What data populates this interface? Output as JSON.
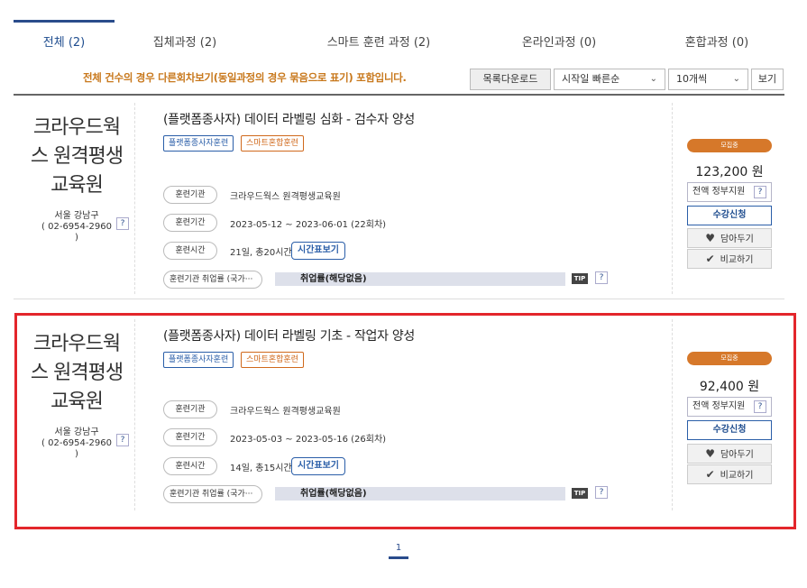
{
  "tabs": [
    {
      "label": "전체 (2)"
    },
    {
      "label": "집체과정 (2)"
    },
    {
      "label": "스마트 훈련 과정 (2)"
    },
    {
      "label": "온라인과정 (0)"
    },
    {
      "label": "혼합과정 (0)"
    }
  ],
  "filter": {
    "notice": "전체 건수의 경우 다른회차보기(동일과정의 경우 묶음으로 표기) 포함입니다.",
    "download_label": "목록다운로드",
    "sort_selected": "시작일 빠른순",
    "page_size_selected": "10개씩",
    "view_label": "보기"
  },
  "courses": [
    {
      "org_name": "크라우드웍스 원격평생교육원",
      "org_region": "서울 강남구",
      "org_phone": "( 02-6954-2960 )",
      "title": "(플랫폼종사자) 데이터 라벨링 심화 - 검수자 양성",
      "badge1": "플랫폼종사자훈련",
      "badge2": "스마트혼합훈련",
      "label_org": "훈련기관",
      "label_period": "훈련기간",
      "label_time": "훈련시간",
      "label_emp": "훈련기관 취업률 (국가···",
      "org_value": "크라우드웍스 원격평생교육원",
      "period_value": "2023-05-12 ~ 2023-06-01 (22회차)",
      "time_value": "21일, 총20시간",
      "schedule_label": "시간표보기",
      "emp_value": "취업률(해당없음)",
      "tip": "TIP",
      "status": "모집중",
      "price": "123,200 원",
      "support_label": "전액 정부지원",
      "apply_label": "수강신청",
      "wish_label": "담아두기",
      "compare_label": "비교하기"
    },
    {
      "org_name": "크라우드웍스 원격평생교육원",
      "org_region": "서울 강남구",
      "org_phone": "( 02-6954-2960 )",
      "title": "(플랫폼종사자) 데이터 라벨링 기초 - 작업자 양성",
      "badge1": "플랫폼종사자훈련",
      "badge2": "스마트혼합훈련",
      "label_org": "훈련기관",
      "label_period": "훈련기간",
      "label_time": "훈련시간",
      "label_emp": "훈련기관 취업률 (국가···",
      "org_value": "크라우드웍스 원격평생교육원",
      "period_value": "2023-05-03 ~ 2023-05-16 (26회차)",
      "time_value": "14일, 총15시간",
      "schedule_label": "시간표보기",
      "emp_value": "취업률(해당없음)",
      "tip": "TIP",
      "status": "모집중",
      "price": "92,400 원",
      "support_label": "전액 정부지원",
      "apply_label": "수강신청",
      "wish_label": "담아두기",
      "compare_label": "비교하기"
    }
  ],
  "pagination": {
    "current": "1"
  },
  "colors": {
    "accent": "#2a4c8c",
    "highlight": "#e3262b",
    "status": "#d6782a",
    "notice": "#c8781c"
  }
}
